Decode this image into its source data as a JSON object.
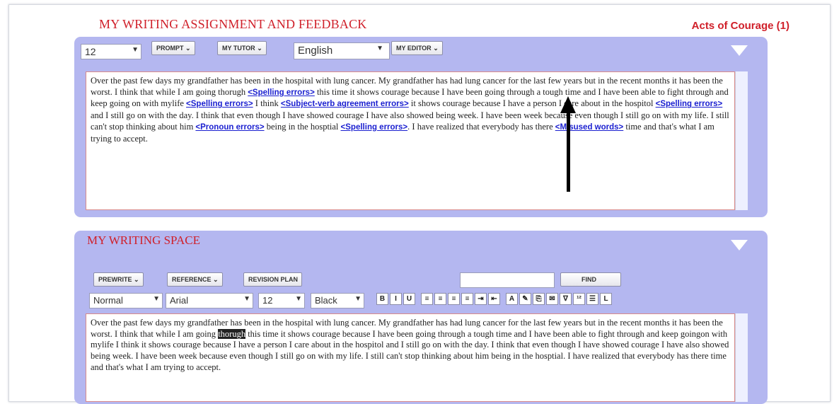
{
  "header": {
    "title": "MY WRITING ASSIGNMENT AND FEEDBACK",
    "assignment": "Acts of Courage (1)"
  },
  "toolbar1": {
    "font_size": "12",
    "prompt": "PROMPT",
    "my_tutor": "MY TUTOR",
    "language": "English",
    "my_editor": "MY EDITOR"
  },
  "feedback": {
    "text": [
      "Over the past few days my grandfather has been in the hospital with lung cancer. My grandfather has had lung cancer for the last few years but in the recent months it has been the worst. I think that while I am going thorugh ",
      {
        "tag": "<Spelling errors>"
      },
      " this time it shows courage because I have been going through a tough time and I have been able to fight through and keep going on with mylife ",
      {
        "tag": "<Spelling errors>"
      },
      " I think ",
      {
        "tag": "<Subject-verb agreement errors>"
      },
      " it shows courage because I have a person I care about in the hospitol ",
      {
        "tag": "<Spelling errors>"
      },
      " and I still go on with the day. I think that even though I have showed courage I have also showed being week. I have been week because even though I still go on with my life. I still can't stop thinking about him ",
      {
        "tag": "<Pronoun errors>"
      },
      " being in the hosptial ",
      {
        "tag": "<Spelling errors>"
      },
      ". I have realized that everybody has there ",
      {
        "tag": "<Misused words>"
      },
      " time and that's what I am trying to accept."
    ]
  },
  "writing_space": {
    "title": "MY WRITING SPACE",
    "prewrite": "PREWRITE",
    "reference": "REFERENCE",
    "revision_plan": "REVISION PLAN",
    "find_label": "FIND",
    "style": "Normal",
    "font": "Arial",
    "size": "12",
    "color": "Black",
    "text_before": "Over the past few days my grandfather has been in the hospital with lung cancer. My grandfather has had lung cancer for the last few years but in the recent months it has been the worst. I think that while I am going ",
    "highlighted": "thorugh",
    "text_after": " this time it shows courage because I have been going through a tough time and I have been able to fight through and keep goingon with mylife I think it shows courage because I have a person I care about in the hospitol and I still go on with the day. I think that even though I have showed courage I have also showed being week. I have been week because even though I still go on with my life. I still can't stop thinking about him being in the hosptial. I have realized that everybody has there time and that's what I am trying to accept."
  },
  "format_buttons": [
    "B",
    "I",
    "U",
    "≡",
    "≡",
    "≡",
    "≡",
    "⇥",
    "⇤",
    "A",
    "✎",
    "⎘",
    "✉",
    "∇",
    "¹²",
    "☰",
    "L"
  ],
  "colors": {
    "accent_red": "#d0202a",
    "panel_blue": "#b4b7f0",
    "tag_blue": "#1a1fd0"
  }
}
